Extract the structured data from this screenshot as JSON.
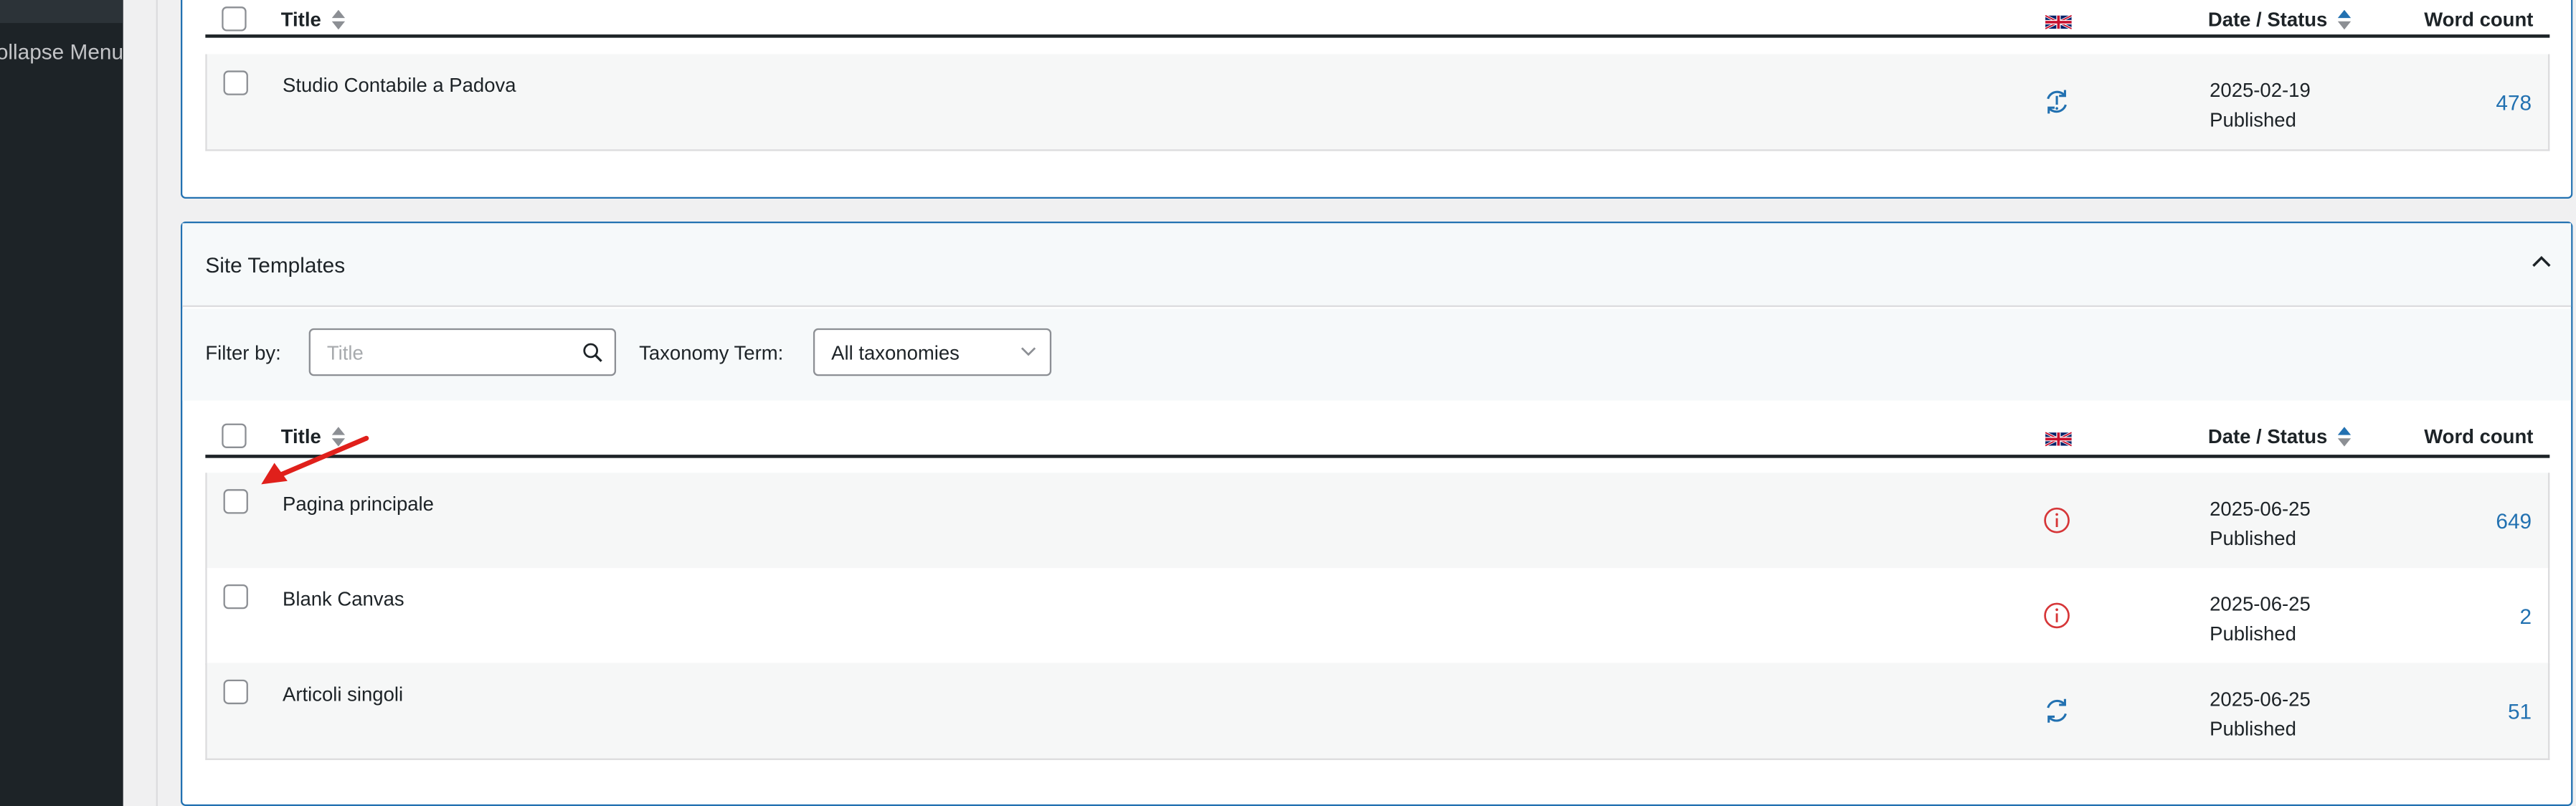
{
  "sidebar": {
    "collapse_label": "Collapse Menu"
  },
  "table_headers": {
    "title": "Title",
    "date_status": "Date / Status",
    "word_count": "Word count"
  },
  "panel1": {
    "rows": [
      {
        "title": "Studio Contabile a Padova",
        "date": "2025-02-19",
        "status": "Published",
        "word_count": "478",
        "status_icon": "sync-icon"
      }
    ]
  },
  "panel2": {
    "title": "Site Templates",
    "filter_label": "Filter by:",
    "search_placeholder": "Title",
    "taxonomy_label": "Taxonomy Term:",
    "taxonomy_value": "All taxonomies",
    "rows": [
      {
        "title": "Pagina principale",
        "date": "2025-06-25",
        "status": "Published",
        "word_count": "649",
        "status_icon": "info-icon"
      },
      {
        "title": "Blank Canvas",
        "date": "2025-06-25",
        "status": "Published",
        "word_count": "2",
        "status_icon": "info-icon"
      },
      {
        "title": "Articoli singoli",
        "date": "2025-06-25",
        "status": "Published",
        "word_count": "51",
        "status_icon": "sync-icon"
      }
    ]
  },
  "colors": {
    "accent": "#2271b1",
    "warning": "#d63638",
    "sync": "#2271b1",
    "annotation_arrow": "#e0201b"
  }
}
